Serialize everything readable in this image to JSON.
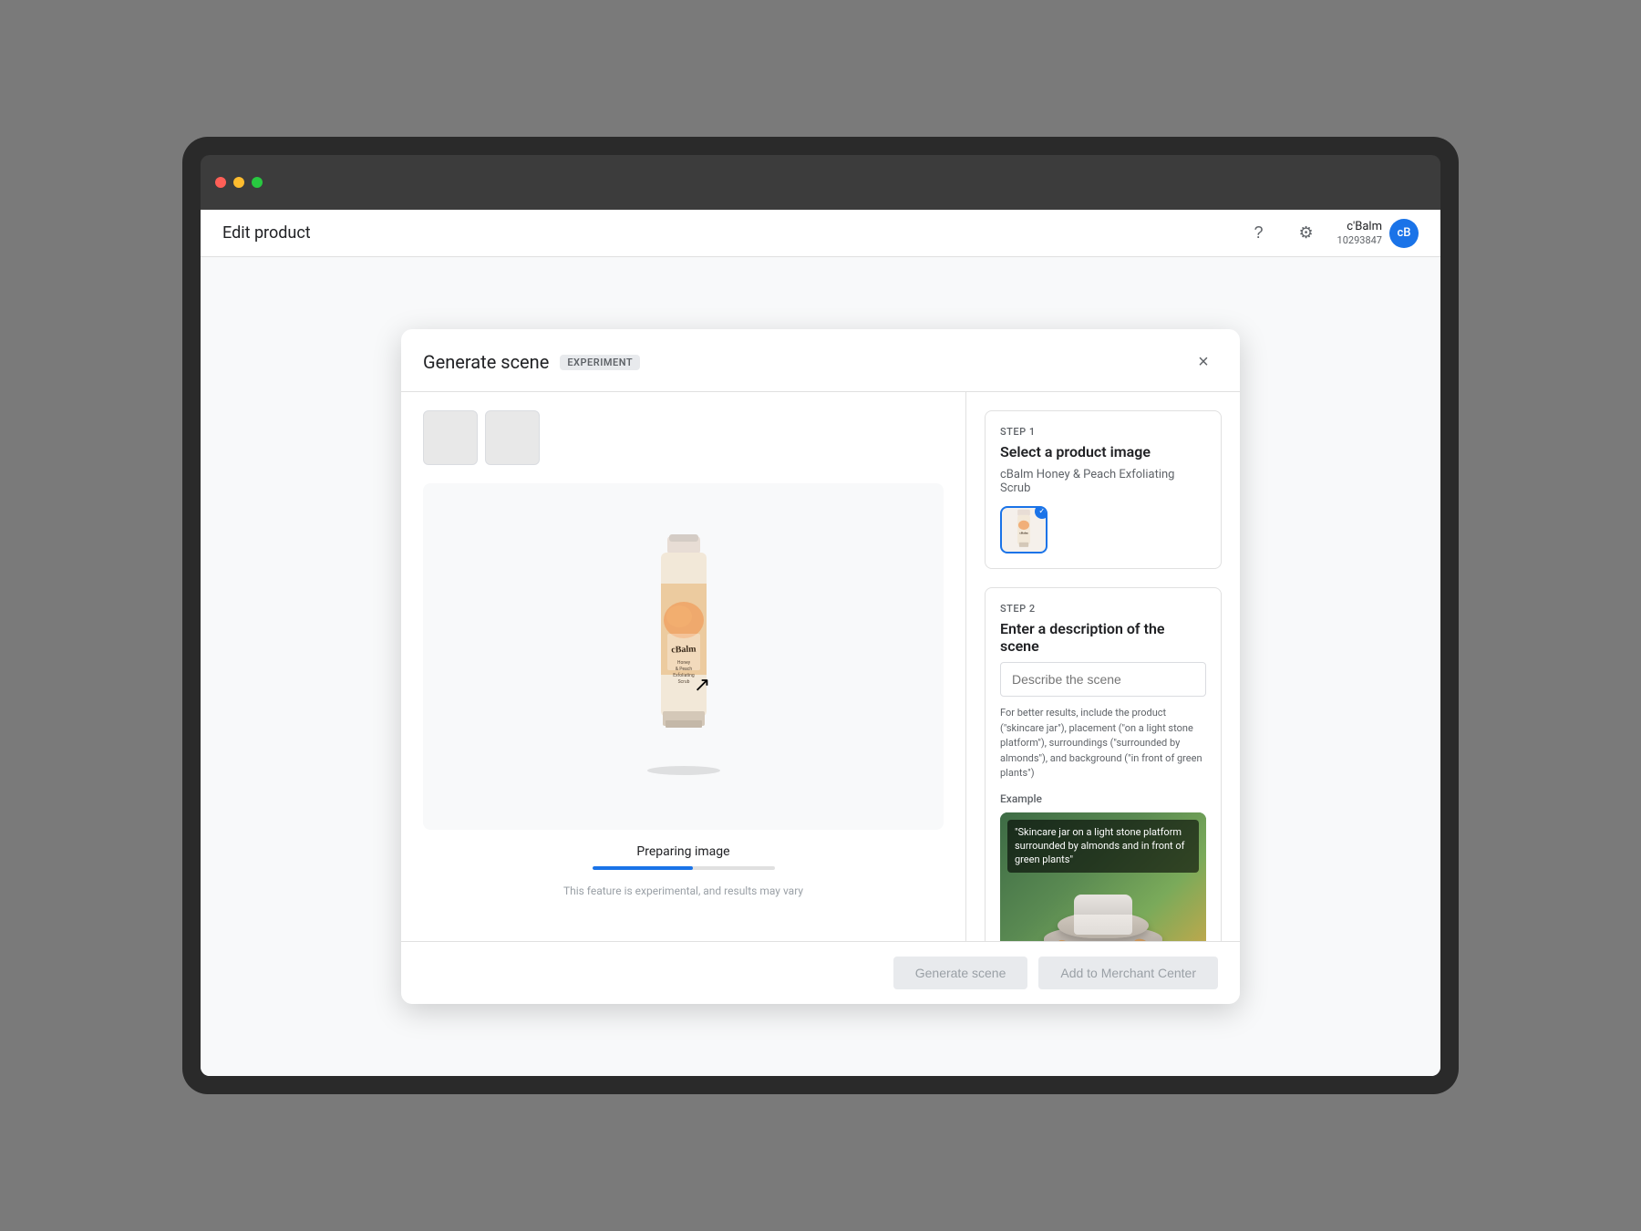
{
  "topbar": {
    "title": "Edit product",
    "help_label": "?",
    "settings_label": "⚙",
    "user_name": "c'Balm",
    "user_id": "10293847",
    "avatar_initials": "cB"
  },
  "modal": {
    "title": "Generate scene",
    "badge": "EXPERIMENT",
    "close_label": "×",
    "preparing_text": "Preparing image",
    "experimental_note": "This feature is experimental, and results may vary",
    "progress_percent": 55,
    "step1": {
      "label": "STEP 1",
      "title": "Select a product image",
      "product_name": "cBalm Honey & Peach Exfoliating Scrub"
    },
    "step2": {
      "label": "STEP 2",
      "title": "Enter a description of the scene",
      "input_placeholder": "Describe the scene",
      "hint": "For better results, include the product (\"skincare jar\"), placement (\"on a light stone platform\"), surroundings (\"surrounded by almonds\"), and background (\"in front of green plants\")",
      "example_label": "Example",
      "example_caption": "\"Skincare jar on a light stone platform surrounded by almonds and in front of green plants\""
    },
    "footer": {
      "generate_label": "Generate scene",
      "add_label": "Add to Merchant Center"
    }
  }
}
